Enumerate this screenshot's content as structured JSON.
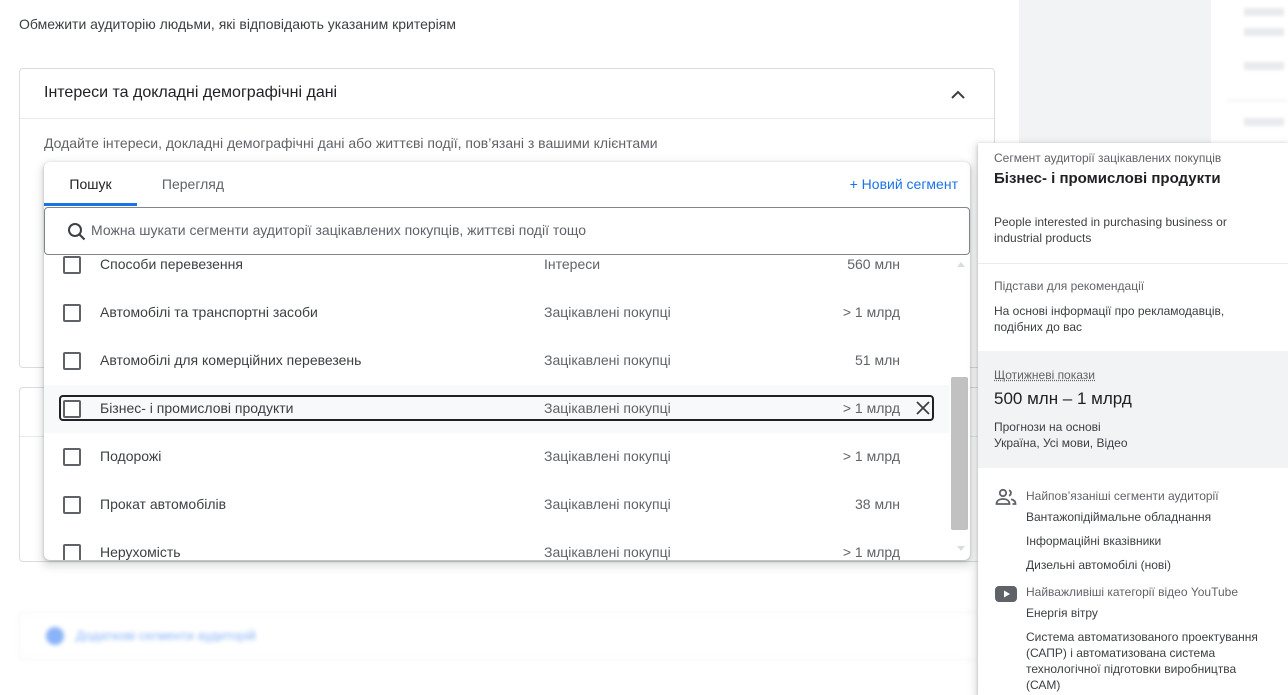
{
  "page": {
    "top_description": "Обмежити аудиторію людьми, які відповідають указаним критеріям",
    "card_title": "Інтереси та докладні демографічні дані",
    "card_hint": "Додайте інтереси, докладні демографічні дані або життєві події, пов’язані з вашими клієнтами",
    "blurred_link": "Додаткові сегменти аудиторій"
  },
  "panel": {
    "tabs": [
      {
        "label": "Пошук",
        "active": true
      },
      {
        "label": "Перегляд",
        "active": false
      }
    ],
    "new_segment_label": "+ Новий сегмент",
    "search_placeholder": "Можна шукати сегменти аудиторії зацікавлених покупців, життєві події тощо",
    "rows": [
      {
        "name": "Способи перевезення",
        "type": "Інтереси",
        "size": "560 млн"
      },
      {
        "name": "Автомобілі та транспортні засоби",
        "type": "Зацікавлені покупці",
        "size": "> 1 млрд"
      },
      {
        "name": "Автомобілі для комерційних перевезень",
        "type": "Зацікавлені покупці",
        "size": "51 млн"
      },
      {
        "name": "Бізнес- і промислові продукти",
        "type": "Зацікавлені покупці",
        "size": "> 1 млрд"
      },
      {
        "name": "Подорожі",
        "type": "Зацікавлені покупці",
        "size": "> 1 млрд"
      },
      {
        "name": "Прокат автомобілів",
        "type": "Зацікавлені покупці",
        "size": "38 млн"
      },
      {
        "name": "Нерухомість",
        "type": "Зацікавлені покупці",
        "size": "> 1 млрд"
      }
    ]
  },
  "side": {
    "category": "Сегмент аудиторії зацікавлених покупців",
    "name": "Бізнес- і промислові продукти",
    "description": "People interested in purchasing business or industrial products",
    "reason_heading": "Підстави для рекомендації",
    "reason": "На основі інформації про рекламодавців, подібних до вас",
    "impressions_heading": "Щотижневі покази",
    "impressions": "500 млн – 1 млрд",
    "forecast_heading": "Прогнози на основі",
    "forecast": "Україна, Усі мови, Відео",
    "related_heading": "Найпов’язаніші сегменти аудиторії",
    "related": [
      "Вантажопідіймальне обладнання",
      "Інформаційні вказівники",
      "Дизельні автомобілі (нові)"
    ],
    "youtube_heading": "Найважливіші категорії відео YouTube",
    "youtube": [
      "Енергія вітру",
      "Система автоматизованого проектування (САПР) і автоматизована система технологічної підготовки виробництва (САМ)"
    ]
  },
  "colors": {
    "accent": "#1a73e8",
    "text": "#202124",
    "muted": "#5f6368"
  }
}
